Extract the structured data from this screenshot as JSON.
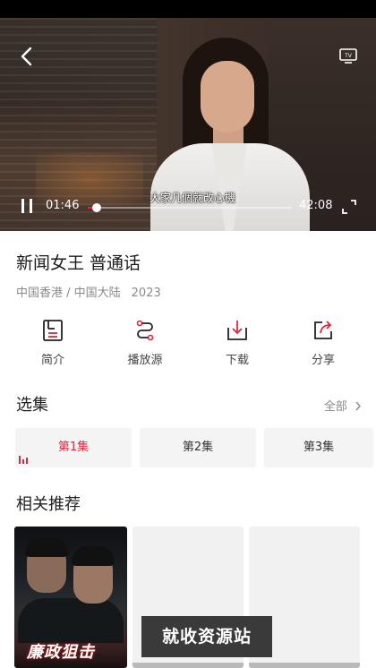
{
  "player": {
    "current_time": "01:46",
    "total_time": "42:08",
    "progress_fraction": 0.042,
    "subtitle": "大家几個就改心機"
  },
  "show": {
    "title": "新闻女王 普通话",
    "regions": "中国香港 / 中国大陆",
    "year": "2023"
  },
  "actions": [
    {
      "label": "简介",
      "icon": "document-icon"
    },
    {
      "label": "播放源",
      "icon": "route-icon"
    },
    {
      "label": "下载",
      "icon": "download-icon"
    },
    {
      "label": "分享",
      "icon": "share-icon"
    }
  ],
  "episodes": {
    "title": "选集",
    "all_label": "全部",
    "items": [
      {
        "label": "第1集",
        "active": true
      },
      {
        "label": "第2集",
        "active": false
      },
      {
        "label": "第3集",
        "active": false
      }
    ]
  },
  "recommend": {
    "title": "相关推荐",
    "items": [
      {
        "poster_title": "廉政狙击"
      },
      {
        "poster_title": ""
      },
      {
        "poster_title": ""
      }
    ]
  },
  "watermark": "就收资源站",
  "colors": {
    "accent": "#e3243b",
    "muted_text": "#8a8a8a",
    "tile_bg": "#f4f4f4"
  }
}
